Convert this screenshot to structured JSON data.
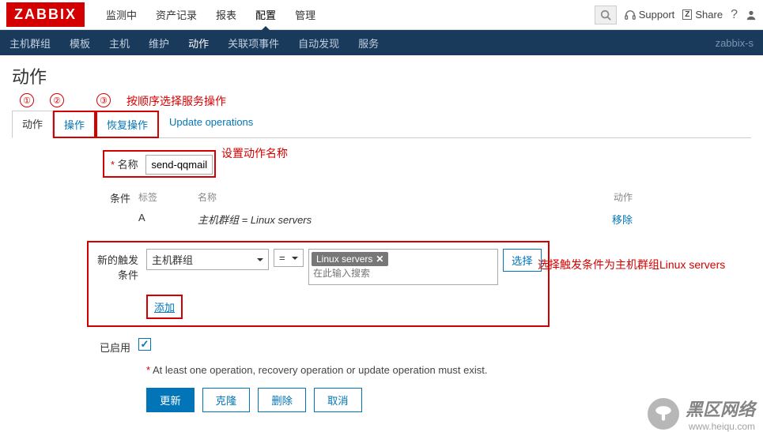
{
  "logo": "ZABBIX",
  "top_menu": [
    "监测中",
    "资产记录",
    "报表",
    "配置",
    "管理"
  ],
  "top_right": {
    "support": "Support",
    "share": "Share"
  },
  "sub_menu": [
    "主机群组",
    "模板",
    "主机",
    "维护",
    "动作",
    "关联项事件",
    "自动发现",
    "服务"
  ],
  "server_name": "zabbix-s",
  "page_title": "动作",
  "circles": [
    "①",
    "②",
    "③"
  ],
  "annot": {
    "order": "按顺序选择服务操作",
    "set_name": "设置动作名称",
    "choose_trigger": "选择触发条件为主机群组Linux servers"
  },
  "tabs": [
    "动作",
    "操作",
    "恢复操作",
    "Update operations"
  ],
  "form": {
    "name_label": "名称",
    "name_value": "send-qqmail",
    "cond_label": "条件",
    "cond_head": {
      "label": "标签",
      "name": "名称",
      "action": "动作"
    },
    "cond_row": {
      "label": "A",
      "name_prefix": "主机群组 = ",
      "name_value": "Linux servers",
      "action": "移除"
    },
    "trigger_label": "新的触发条件",
    "trigger_sel1": "主机群组",
    "trigger_sel2": "=",
    "tag_text": "Linux servers",
    "tag_placeholder": "在此输入搜索",
    "select_btn": "选择",
    "add_link": "添加",
    "enabled_label": "已启用",
    "warn": "At least one operation, recovery operation or update operation must exist.",
    "buttons": [
      "更新",
      "克隆",
      "删除",
      "取消"
    ]
  },
  "watermark": {
    "title": "黑区网络",
    "url": "www.heiqu.com"
  }
}
